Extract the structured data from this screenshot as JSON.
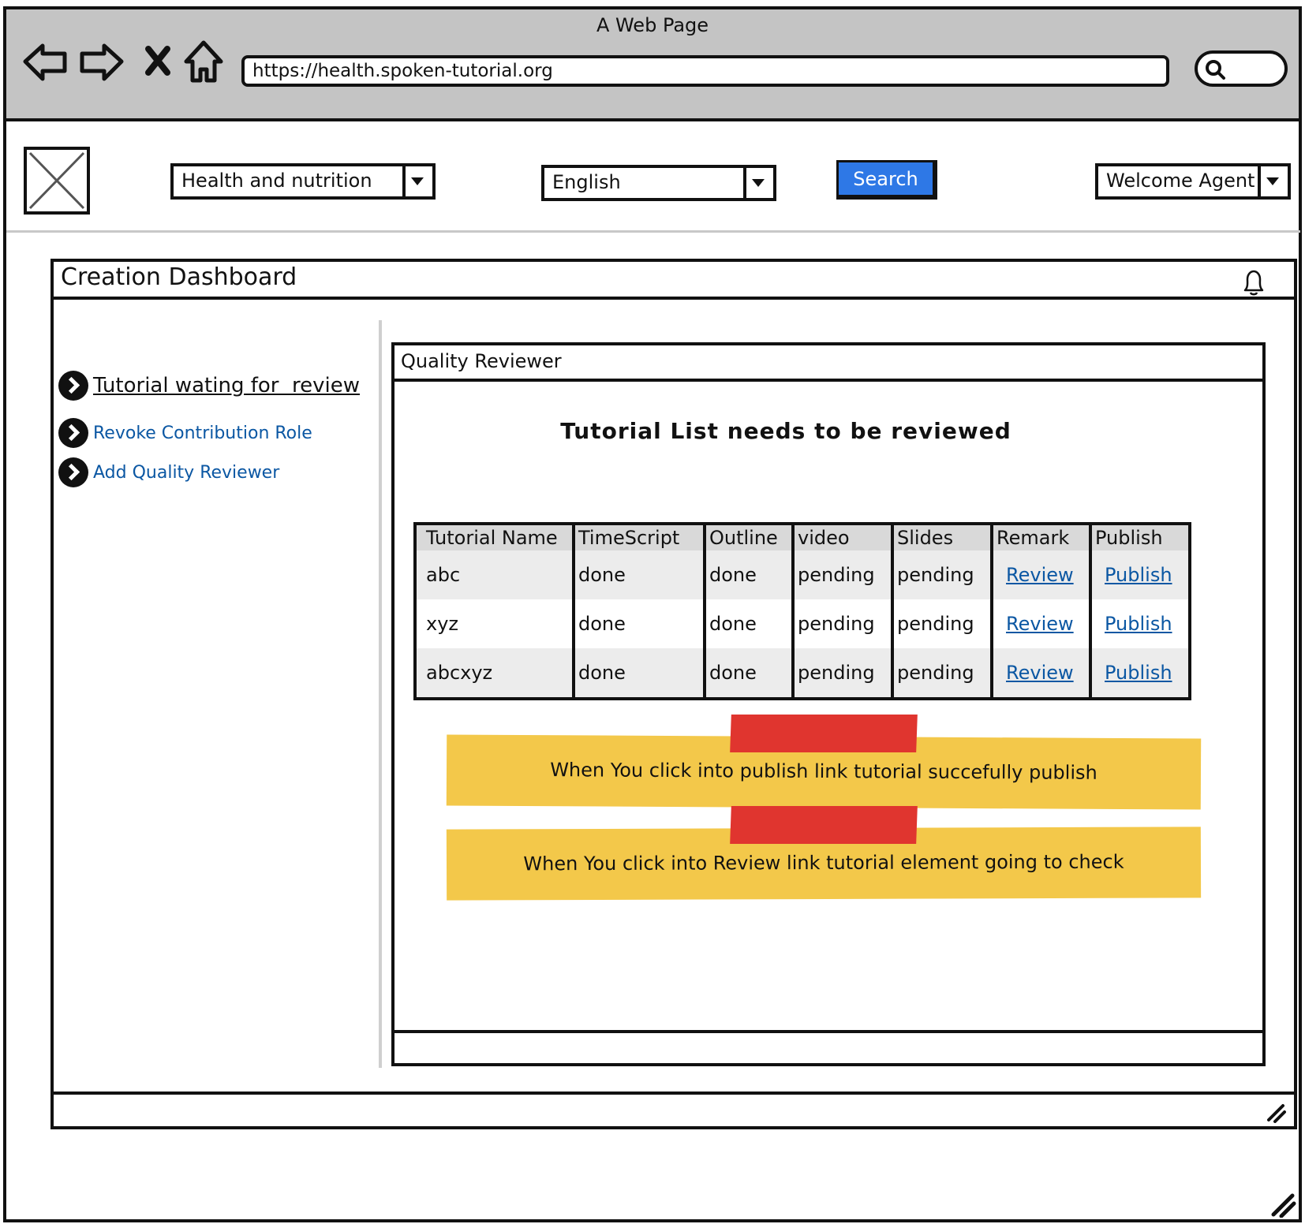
{
  "browser": {
    "window_title": "A Web Page",
    "url": "https://health.spoken-tutorial.org"
  },
  "header": {
    "category_select": "Health and nutrition",
    "language_select": "English",
    "search_label": "Search",
    "user_menu": "Welcome Agent",
    "search_button_color": "#2e78e6"
  },
  "dashboard": {
    "title": "Creation Dashboard"
  },
  "sidebar": {
    "items": [
      {
        "label": "Tutorial wating for  review"
      },
      {
        "label": "Revoke Contribution Role"
      },
      {
        "label": "Add Quality Reviewer"
      }
    ]
  },
  "panel": {
    "title": "Quality Reviewer",
    "heading": "Tutorial List needs to be reviewed",
    "table": {
      "columns": [
        "Tutorial Name",
        "TimeScript",
        "Outline",
        "video",
        "Slides",
        "Remark",
        "Publish"
      ],
      "rows": [
        [
          "abc",
          "done",
          "done",
          "pending",
          "pending",
          "Review",
          "Publish"
        ],
        [
          "xyz",
          "done",
          "done",
          "pending",
          "pending",
          "Review",
          "Publish"
        ],
        [
          "abcxyz",
          "done",
          "done",
          "pending",
          "pending",
          "Review",
          "Publish"
        ]
      ]
    },
    "notes": [
      "When You click into publish link tutorial succefully publish",
      "When You click into Review link tutorial element going to check"
    ],
    "note_color": "#f3c84a",
    "tape_color": "#e0352f"
  }
}
